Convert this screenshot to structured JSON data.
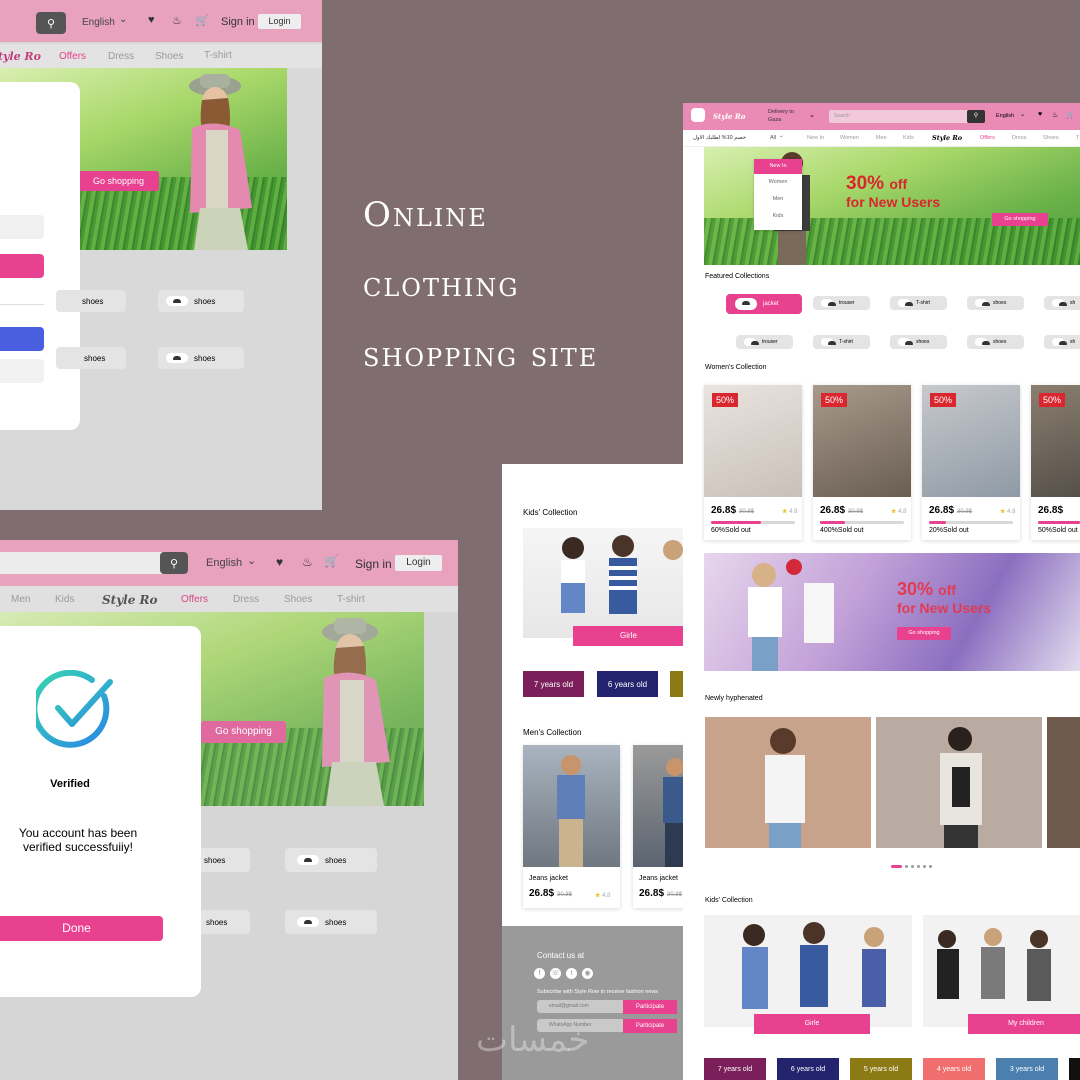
{
  "headline": [
    "Online",
    "clothing",
    "shopping site"
  ],
  "topleft": {
    "language": "English",
    "signin": "Sign in",
    "login": "Login",
    "brand": "Style Ro",
    "nav": [
      "Offers",
      "Dress",
      "Shoes",
      "T-shirt"
    ],
    "cta": "Go shopping",
    "chips": [
      "shoes",
      "shoes",
      "shoes",
      "shoes"
    ]
  },
  "bottomleft": {
    "language": "English",
    "signin": "Sign in",
    "login": "Login",
    "nav_pre": [
      "Men",
      "Kids"
    ],
    "brand": "Style Ro",
    "nav": [
      "Offers",
      "Dress",
      "Shoes",
      "T-shirt"
    ],
    "cta": "Go shopping",
    "chips": [
      "shoes",
      "shoes",
      "shoes",
      "shoes"
    ],
    "modal": {
      "title": "Verified",
      "message": "You account has been verified successfuiiy!",
      "done": "Done"
    }
  },
  "middle": {
    "kids_title": "Kids' Collection",
    "girls": "Girle",
    "ages": [
      "7 years old",
      "6 years old"
    ],
    "mens_title": "Men's Collection",
    "products": [
      {
        "name": "Jeans jacket",
        "price": "26.8$",
        "old": "30.8$",
        "rating": "4.8"
      },
      {
        "name": "Jeans jacket",
        "price": "26.8$",
        "old": "30.8$"
      }
    ],
    "contact": "Contact us at",
    "subscribe": "Subscribe with Style Row to receive fashion news",
    "fields": [
      "email@gmail.com",
      "WhatsApp Number"
    ],
    "participate": "Participate"
  },
  "right": {
    "brand": "Style Ro",
    "delivery": "Delivery to",
    "city": "Gaza",
    "search_placeholder": "Search",
    "language": "English",
    "promo_ar": "خصم 10% لطلبك الاول",
    "nav": [
      "All",
      "New In",
      "Women",
      "Men",
      "Kids",
      "Style Ro",
      "Offers",
      "Dress",
      "Shoes",
      "T"
    ],
    "dropdown": [
      "New In",
      "Women",
      "Men",
      "Kids"
    ],
    "hero": {
      "pct": "30%",
      "off": "off",
      "sub": "for New Users",
      "cta": "Go shopping"
    },
    "featured_title": "Featured Collections",
    "featured": [
      "jacket",
      "trouser",
      "T-shirt",
      "shoes",
      "sh",
      "trouser",
      "T-shirt",
      "shoes",
      "shoes",
      "sh"
    ],
    "women_title": "Women's Collection",
    "women": [
      {
        "badge": "50%",
        "price": "26.8$",
        "old": "30.8$",
        "rating": "4.8",
        "sold": "60%Sold out",
        "progress": 0.6
      },
      {
        "badge": "50%",
        "price": "26.8$",
        "old": "30.8$",
        "rating": "4.8",
        "sold": "400%Sold out",
        "progress": 0.3
      },
      {
        "badge": "50%",
        "price": "26.8$",
        "old": "30.8$",
        "rating": "4.8",
        "sold": "20%Sold out",
        "progress": 0.2
      },
      {
        "badge": "50%",
        "price": "26.8$",
        "sold": "50%Sold out",
        "progress": 0.5
      }
    ],
    "banner2": {
      "pct": "30%",
      "off": "off",
      "sub": "for New Users",
      "cta": "Go shopping"
    },
    "newly_title": "Newly hyphenated",
    "kids_title": "Kids' Collection",
    "kids_labels": [
      "Girle",
      "My children"
    ],
    "ages": [
      {
        "label": "7 years old",
        "color": "#7a1f5a"
      },
      {
        "label": "6 years old",
        "color": "#24236e"
      },
      {
        "label": "5 years old",
        "color": "#8c7a15"
      },
      {
        "label": "4 years old",
        "color": "#f06e6e"
      },
      {
        "label": "3 years old",
        "color": "#4a7fae"
      }
    ]
  },
  "watermark": "خمسات"
}
